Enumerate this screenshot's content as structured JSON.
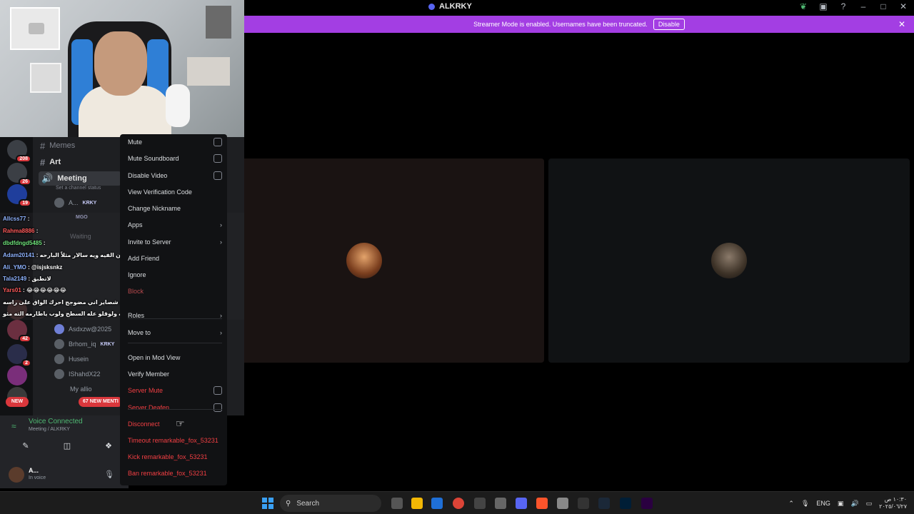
{
  "window": {
    "title": "ALKRKY",
    "controls": [
      "leaf-icon",
      "inbox-icon",
      "help-icon",
      "minimize-icon",
      "maximize-icon",
      "close-icon"
    ]
  },
  "banner": {
    "text": "Streamer Mode is enabled. Usernames have been truncated.",
    "button": "Disable"
  },
  "servers": [
    {
      "badge": "208"
    },
    {
      "badge": "26"
    },
    {
      "badge": "19"
    },
    {
      "badge": ""
    },
    {
      "badge": "42"
    },
    {
      "badge": "2"
    },
    {
      "badge": ""
    },
    {
      "badge": ""
    }
  ],
  "new_pill": "NEW",
  "channels": {
    "items": [
      {
        "name": "Memes"
      },
      {
        "name": "Art"
      },
      {
        "name": "Meeting"
      }
    ],
    "channel_status": "Set a channel status",
    "waiting": "Waiting",
    "members": [
      {
        "name": "A...",
        "tag": "KRKY"
      },
      {
        "name": "",
        "tag": "MGO"
      },
      {
        "name": "Asdxzw@2025",
        "tag": ""
      },
      {
        "name": "Brhom_iq",
        "tag": "KRKY"
      },
      {
        "name": "Husein",
        "tag": ""
      },
      {
        "name": "IShahdX22",
        "tag": ""
      },
      {
        "name": "My allio",
        "tag": ""
      }
    ],
    "new_mentions": "67 NEW MENTI"
  },
  "chat": [
    {
      "user": "Allcss77",
      "msg": ":"
    },
    {
      "user": "Rahma8886",
      "msg": ":"
    },
    {
      "user": "dbdfdngd5485",
      "msg": ":"
    },
    {
      "user": "Adam20141",
      "msg": ": عمو اكل القون الفيه ويه سالار مثلاً البارحه"
    },
    {
      "user": "Ali_YMO",
      "msg": ": @isjsksnkz"
    },
    {
      "user": "Tala2149",
      "msg": ": لاتطبق"
    },
    {
      "user": "Yars01",
      "msg": ": 😂😂😂😂😂😂"
    },
    {
      "user": "",
      "msg": "شلو شبيح شصاير اني مضوجج احرك الواق على راسه"
    },
    {
      "user": "",
      "msg": "وكله ولوقلو عله السطح ولوب ياطارمه الته مثو"
    }
  ],
  "voice": {
    "status": "Voice Connected",
    "location": "Meeting / ALKRKY",
    "user_name": "A...",
    "user_status": "In voice"
  },
  "context_menu": [
    {
      "label": "Mute",
      "kind": "check",
      "style": "normal"
    },
    {
      "label": "Mute Soundboard",
      "kind": "check",
      "style": "normal"
    },
    {
      "label": "Disable Video",
      "kind": "check",
      "style": "normal"
    },
    {
      "label": "View Verification Code",
      "kind": "plain",
      "style": "normal"
    },
    {
      "label": "Change Nickname",
      "kind": "plain",
      "style": "normal"
    },
    {
      "label": "Apps",
      "kind": "sub",
      "style": "normal"
    },
    {
      "label": "Invite to Server",
      "kind": "sub",
      "style": "normal"
    },
    {
      "label": "Add Friend",
      "kind": "plain",
      "style": "normal"
    },
    {
      "label": "Ignore",
      "kind": "plain",
      "style": "normal"
    },
    {
      "label": "Block",
      "kind": "plain",
      "style": "danger-dim"
    },
    {
      "label": "Roles",
      "kind": "sub",
      "style": "normal"
    },
    {
      "label": "Move to",
      "kind": "sub",
      "style": "normal"
    },
    {
      "label": "Open in Mod View",
      "kind": "plain",
      "style": "normal"
    },
    {
      "label": "Verify Member",
      "kind": "plain",
      "style": "normal"
    },
    {
      "label": "Server Mute",
      "kind": "check",
      "style": "danger"
    },
    {
      "label": "Server Deafen",
      "kind": "check",
      "style": "danger"
    },
    {
      "label": "Disconnect",
      "kind": "plain",
      "style": "danger"
    },
    {
      "label": "Timeout remarkable_fox_53231",
      "kind": "plain",
      "style": "danger"
    },
    {
      "label": "Kick remarkable_fox_53231",
      "kind": "plain",
      "style": "danger"
    },
    {
      "label": "Ban remarkable_fox_53231",
      "kind": "plain",
      "style": "danger"
    }
  ],
  "taskbar": {
    "search_label": "Search",
    "lang": "ENG",
    "clock_time": "١٠:٣٠ ص",
    "clock_date": "٢٠٢٥/٠٦/٢٧"
  }
}
